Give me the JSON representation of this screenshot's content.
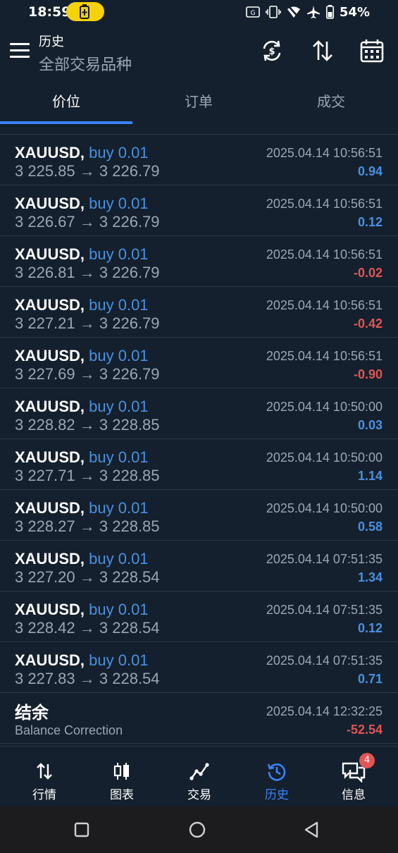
{
  "status_bar": {
    "time": "18:59",
    "battery_pct": "54%",
    "icons": [
      "battery-saver-icon",
      "screenshot-icon",
      "vibrate-icon",
      "wifi-off-icon",
      "airplane-icon",
      "battery-icon"
    ]
  },
  "header": {
    "title": "历史",
    "subtitle": "全部交易品种",
    "buttons": [
      "sync-icon",
      "sort-icon",
      "calendar-icon"
    ]
  },
  "tabs": [
    {
      "label": "价位",
      "active": true
    },
    {
      "label": "订单",
      "active": false
    },
    {
      "label": "成交",
      "active": false
    }
  ],
  "deals": [
    {
      "symbol": "XAUUSD,",
      "side": "buy 0.01",
      "open": "3 225.85",
      "arrow": "→",
      "close": "3 226.79",
      "time": "2025.04.14 10:56:51",
      "profit": "0.94",
      "positive": true
    },
    {
      "symbol": "XAUUSD,",
      "side": "buy 0.01",
      "open": "3 226.67",
      "arrow": "→",
      "close": "3 226.79",
      "time": "2025.04.14 10:56:51",
      "profit": "0.12",
      "positive": true
    },
    {
      "symbol": "XAUUSD,",
      "side": "buy 0.01",
      "open": "3 226.81",
      "arrow": "→",
      "close": "3 226.79",
      "time": "2025.04.14 10:56:51",
      "profit": "-0.02",
      "positive": false
    },
    {
      "symbol": "XAUUSD,",
      "side": "buy 0.01",
      "open": "3 227.21",
      "arrow": "→",
      "close": "3 226.79",
      "time": "2025.04.14 10:56:51",
      "profit": "-0.42",
      "positive": false
    },
    {
      "symbol": "XAUUSD,",
      "side": "buy 0.01",
      "open": "3 227.69",
      "arrow": "→",
      "close": "3 226.79",
      "time": "2025.04.14 10:56:51",
      "profit": "-0.90",
      "positive": false
    },
    {
      "symbol": "XAUUSD,",
      "side": "buy 0.01",
      "open": "3 228.82",
      "arrow": "→",
      "close": "3 228.85",
      "time": "2025.04.14 10:50:00",
      "profit": "0.03",
      "positive": true
    },
    {
      "symbol": "XAUUSD,",
      "side": "buy 0.01",
      "open": "3 227.71",
      "arrow": "→",
      "close": "3 228.85",
      "time": "2025.04.14 10:50:00",
      "profit": "1.14",
      "positive": true
    },
    {
      "symbol": "XAUUSD,",
      "side": "buy 0.01",
      "open": "3 228.27",
      "arrow": "→",
      "close": "3 228.85",
      "time": "2025.04.14 10:50:00",
      "profit": "0.58",
      "positive": true
    },
    {
      "symbol": "XAUUSD,",
      "side": "buy 0.01",
      "open": "3 227.20",
      "arrow": "→",
      "close": "3 228.54",
      "time": "2025.04.14 07:51:35",
      "profit": "1.34",
      "positive": true
    },
    {
      "symbol": "XAUUSD,",
      "side": "buy 0.01",
      "open": "3 228.42",
      "arrow": "→",
      "close": "3 228.54",
      "time": "2025.04.14 07:51:35",
      "profit": "0.12",
      "positive": true
    },
    {
      "symbol": "XAUUSD,",
      "side": "buy 0.01",
      "open": "3 227.83",
      "arrow": "→",
      "close": "3 228.54",
      "time": "2025.04.14 07:51:35",
      "profit": "0.71",
      "positive": true
    }
  ],
  "balance": {
    "title": "结余",
    "subtitle": "Balance Correction",
    "time": "2025.04.14 12:32:25",
    "amount": "-52.54"
  },
  "bottom_nav": [
    {
      "label": "行情",
      "icon": "quotes-icon",
      "active": false
    },
    {
      "label": "图表",
      "icon": "chart-icon",
      "active": false
    },
    {
      "label": "交易",
      "icon": "trade-icon",
      "active": false
    },
    {
      "label": "历史",
      "icon": "history-icon",
      "active": true
    },
    {
      "label": "信息",
      "icon": "messages-icon",
      "active": false,
      "badge": "4"
    }
  ],
  "colors": {
    "background": "#14202d",
    "accent": "#3b82f6",
    "positive": "#4a90e2",
    "negative": "#e05555",
    "muted": "#9aa6b4"
  }
}
